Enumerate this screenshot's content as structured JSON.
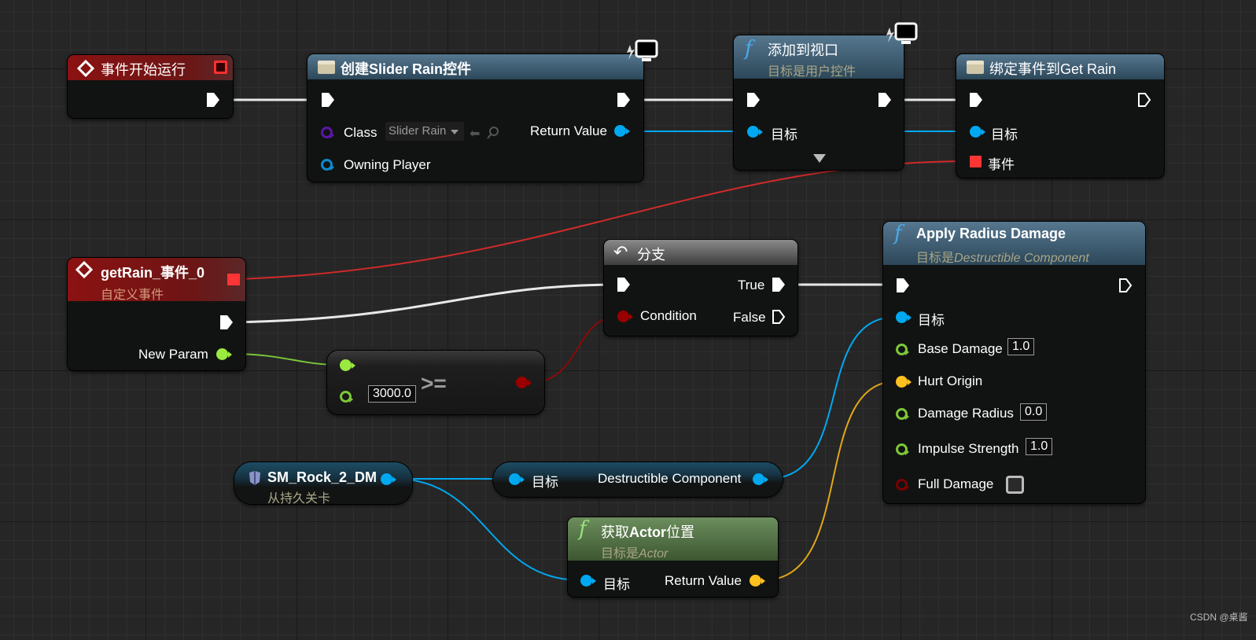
{
  "nodes": {
    "begin_play": {
      "title": "事件开始运行"
    },
    "create_widget": {
      "title": "创建Slider Rain控件",
      "class_label": "Class",
      "class_value": "Slider Rain",
      "owning_player": "Owning Player",
      "return_value": "Return Value"
    },
    "add_to_viewport": {
      "title": "添加到视口",
      "subtitle": "目标是用户控件",
      "target": "目标"
    },
    "bind_event": {
      "title": "绑定事件到Get Rain",
      "target": "目标",
      "event": "事件"
    },
    "custom_event": {
      "title": "getRain_事件_0",
      "subtitle": "自定义事件",
      "param": "New Param"
    },
    "compare": {
      "operator": ">=",
      "value": "3000.0"
    },
    "branch": {
      "title": "分支",
      "condition": "Condition",
      "true": "True",
      "false": "False"
    },
    "apply_damage": {
      "title": "Apply Radius Damage",
      "subtitle_prefix": "目标是",
      "subtitle_class": "Destructible Component",
      "pins": [
        {
          "label": "目标",
          "value": null
        },
        {
          "label": "Base Damage",
          "value": "1.0"
        },
        {
          "label": "Hurt Origin",
          "value": null
        },
        {
          "label": "Damage Radius",
          "value": "0.0"
        },
        {
          "label": "Impulse Strength",
          "value": "1.0"
        },
        {
          "label": "Full Damage",
          "value": null
        }
      ],
      "full_damage_checked": false
    },
    "rock_ref": {
      "title": "SM_Rock_2_DM",
      "subtitle": "从持久关卡"
    },
    "get_component": {
      "target": "目标",
      "output": "Destructible Component"
    },
    "get_location": {
      "title_prefix": "获取",
      "title_bold": "Actor",
      "title_suffix": "位置",
      "subtitle_prefix": "目标是",
      "subtitle_class": "Actor",
      "target": "目标",
      "return_value": "Return Value"
    }
  },
  "colors": {
    "exec": "#ffffff",
    "object": "#00a8f0",
    "float": "#9ae840",
    "bool": "#9a0000",
    "vector": "#fdc11f",
    "delegate": "#ff3838",
    "class": "#5b16a8"
  },
  "watermark": "CSDN @桌酱"
}
